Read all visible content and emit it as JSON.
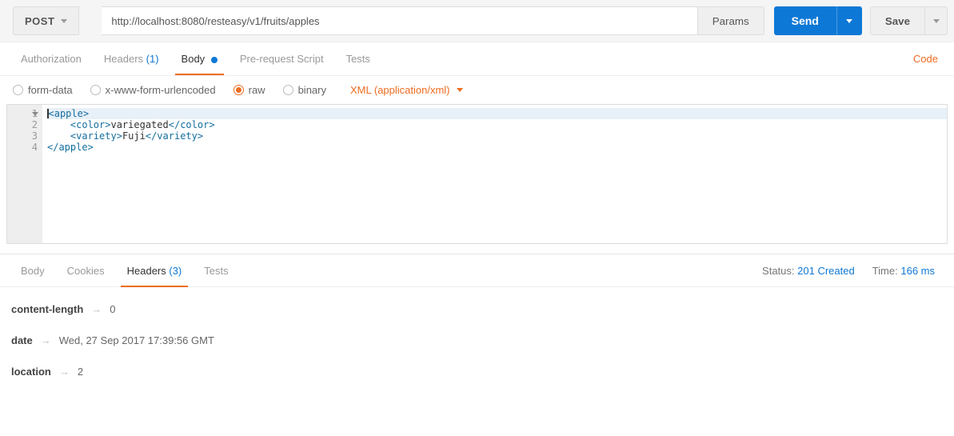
{
  "toolbar": {
    "method": "POST",
    "url": "http://localhost:8080/resteasy/v1/fruits/apples",
    "params_label": "Params",
    "send_label": "Send",
    "save_label": "Save"
  },
  "request_tabs": {
    "authorization": "Authorization",
    "headers_label": "Headers",
    "headers_count": "(1)",
    "body": "Body",
    "pre_request": "Pre-request Script",
    "tests": "Tests",
    "code_link": "Code"
  },
  "body_options": {
    "form_data": "form-data",
    "urlencoded": "x-www-form-urlencoded",
    "raw": "raw",
    "binary": "binary",
    "content_type": "XML (application/xml)"
  },
  "editor": {
    "lines": [
      "1",
      "2",
      "3",
      "4"
    ],
    "l1_t1": "<",
    "l1_t2": "apple",
    "l1_t3": ">",
    "l2_t1": "    <",
    "l2_t2": "color",
    "l2_t3": ">",
    "l2_text": "variegated",
    "l2_t4": "</",
    "l2_t5": "color",
    "l2_t6": ">",
    "l3_t1": "    <",
    "l3_t2": "variety",
    "l3_t3": ">",
    "l3_text": "Fuji",
    "l3_t4": "</",
    "l3_t5": "variety",
    "l3_t6": ">",
    "l4_t1": "</",
    "l4_t2": "apple",
    "l4_t3": ">"
  },
  "response_tabs": {
    "body": "Body",
    "cookies": "Cookies",
    "headers_label": "Headers",
    "headers_count": "(3)",
    "tests": "Tests"
  },
  "response_meta": {
    "status_label": "Status:",
    "status_value": "201 Created",
    "time_label": "Time:",
    "time_value": "166 ms"
  },
  "response_headers": [
    {
      "name": "content-length",
      "value": "0"
    },
    {
      "name": "date",
      "value": "Wed, 27 Sep 2017 17:39:56 GMT"
    },
    {
      "name": "location",
      "value": "2"
    }
  ]
}
